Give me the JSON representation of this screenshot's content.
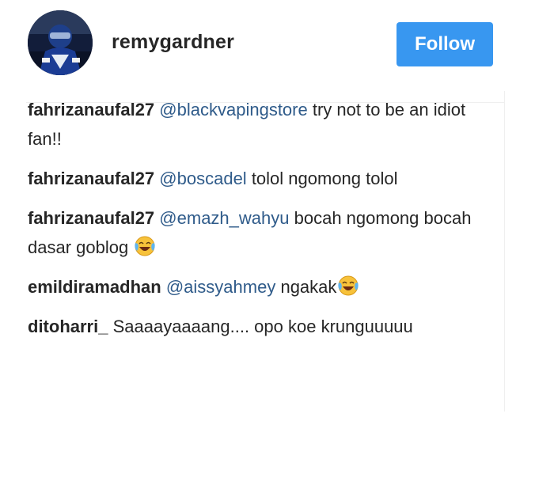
{
  "header": {
    "username": "remygardner",
    "follow_label": "Follow",
    "avatar_icon": "profile-photo-racer-avatar",
    "follow_color": "#3897f0"
  },
  "colors": {
    "mention": "#2f5b8a",
    "text": "#262626",
    "divider": "#efefef"
  },
  "comments": [
    {
      "user": "fahrizanaufal27",
      "mention": "@blackvapingstore",
      "text": " try not to be an idiot fan!!",
      "emoji": ""
    },
    {
      "user": "fahrizanaufal27",
      "mention": "@boscadel",
      "text": " tolol ngomong tolol",
      "emoji": ""
    },
    {
      "user": "fahrizanaufal27",
      "mention": "@emazh_wahyu",
      "text": " bocah ngomong bocah dasar goblog ",
      "emoji": "face-with-tears-of-joy"
    },
    {
      "user": "emildiramadhan",
      "mention": "@aissyahmey",
      "text": " ngakak",
      "emoji": "face-with-tears-of-joy"
    },
    {
      "user": "ditoharri_",
      "mention": "",
      "text": " Saaaayaaaang.... opo koe krunguuuuu",
      "emoji": ""
    }
  ]
}
